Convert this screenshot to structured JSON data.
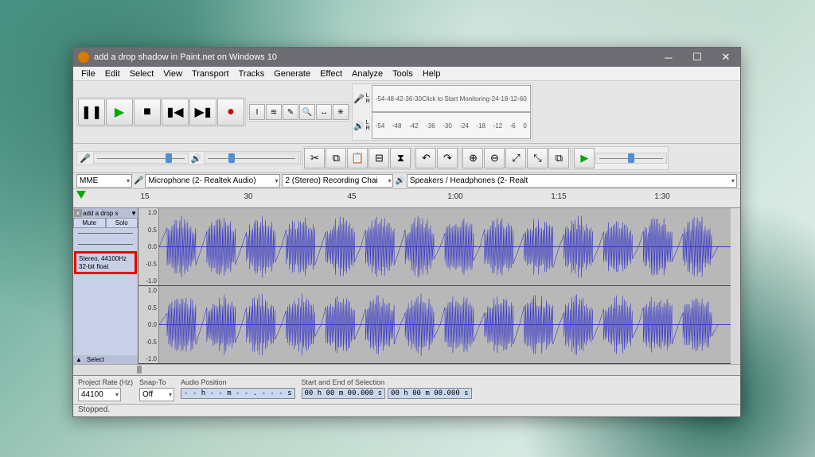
{
  "titlebar": {
    "title": "add a drop shadow in Paint.net on Windows 10"
  },
  "menu": [
    "File",
    "Edit",
    "Select",
    "View",
    "Transport",
    "Tracks",
    "Generate",
    "Effect",
    "Analyze",
    "Tools",
    "Help"
  ],
  "meter": {
    "click_text": "Click to Start Monitoring",
    "ticks": [
      "-54",
      "-48",
      "-42",
      "-36",
      "-30",
      "-24",
      "-18",
      "-12",
      "-6",
      "0"
    ]
  },
  "device": {
    "host": "MME",
    "input": "Microphone (2- Realtek Audio)",
    "channels": "2 (Stereo) Recording Chai",
    "output": "Speakers / Headphones (2- Realt"
  },
  "ruler": {
    "ticks": [
      "15",
      "30",
      "45",
      "1:00",
      "1:15",
      "1:30"
    ]
  },
  "track": {
    "name": "add a drop s",
    "mute": "Mute",
    "solo": "Solo",
    "info1": "Stereo, 44100Hz",
    "info2": "32-bit float",
    "select": "Select",
    "scale": [
      "1.0",
      "0.5",
      "0.0",
      "-0.5",
      "-1.0"
    ]
  },
  "bottom": {
    "rate_label": "Project Rate (Hz)",
    "rate": "44100",
    "snap_label": "Snap-To",
    "snap": "Off",
    "pos_label": "Audio Position",
    "pos": "- - h - - m - - . - - - s",
    "sel_label": "Start and End of Selection",
    "sel1": "00 h 00 m 00.000 s",
    "sel2": "00 h 00 m 00.000 s"
  },
  "status": "Stopped."
}
